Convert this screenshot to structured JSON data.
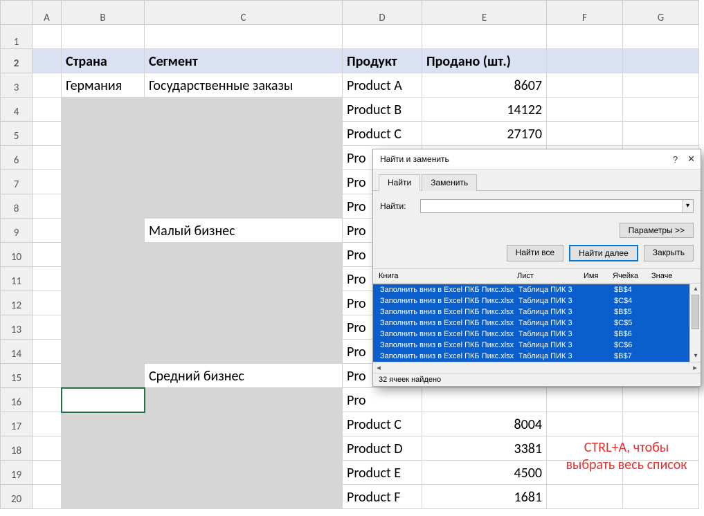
{
  "columns": [
    "A",
    "B",
    "C",
    "D",
    "E",
    "F",
    "G"
  ],
  "rows_count": 20,
  "header_row": {
    "B": "Страна",
    "C": "Сегмент",
    "D": "Продукт",
    "E": "Продано (шт.)"
  },
  "data": {
    "3": {
      "B": "Германия",
      "C": "Государственные заказы",
      "D": "Product A",
      "E": "8607"
    },
    "4": {
      "D": "Product B",
      "E": "14122"
    },
    "5": {
      "D": "Product C",
      "E": "27170"
    },
    "6": {
      "D": "Pro"
    },
    "7": {
      "D": "Pro"
    },
    "8": {
      "D": "Pro"
    },
    "9": {
      "C": "Малый бизнес",
      "D": "Pro"
    },
    "10": {
      "D": "Pro"
    },
    "11": {
      "D": "Pro"
    },
    "12": {
      "D": "Pro"
    },
    "13": {
      "D": "Pro"
    },
    "14": {
      "D": "Pro"
    },
    "15": {
      "C": "Средний бизнес",
      "D": "Pro"
    },
    "16": {
      "D": "Pro"
    },
    "17": {
      "D": "Product C",
      "E": "8004"
    },
    "18": {
      "D": "Product D",
      "E": "3381"
    },
    "19": {
      "D": "Product E",
      "E": "4500"
    },
    "20": {
      "D": "Product F",
      "E": "1681"
    }
  },
  "annotation": {
    "line1": "CTRL+A, чтобы",
    "line2": "выбрать весь список"
  },
  "dialog": {
    "title": "Найти и заменить",
    "help": "?",
    "close": "✕",
    "tabs": {
      "find": "Найти",
      "replace": "Заменить"
    },
    "find_label": "Найти:",
    "params_btn": "Параметры >>",
    "find_all": "Найти все",
    "find_next": "Найти далее",
    "close_btn": "Закрыть",
    "cols": {
      "book": "Книга",
      "sheet": "Лист",
      "name": "Имя",
      "cell": "Ячейка",
      "value": "Значе"
    },
    "results": [
      {
        "book": "Заполнить вниз в Excel ПКБ Пикс.xlsx",
        "sheet": "Таблица ПИК 3",
        "cell": "$B$4"
      },
      {
        "book": "Заполнить вниз в Excel ПКБ Пикс.xlsx",
        "sheet": "Таблица ПИК 3",
        "cell": "$C$4"
      },
      {
        "book": "Заполнить вниз в Excel ПКБ Пикс.xlsx",
        "sheet": "Таблица ПИК 3",
        "cell": "$B$5"
      },
      {
        "book": "Заполнить вниз в Excel ПКБ Пикс.xlsx",
        "sheet": "Таблица ПИК 3",
        "cell": "$C$5"
      },
      {
        "book": "Заполнить вниз в Excel ПКБ Пикс.xlsx",
        "sheet": "Таблица ПИК 3",
        "cell": "$B$6"
      },
      {
        "book": "Заполнить вниз в Excel ПКБ Пикс.xlsx",
        "sheet": "Таблица ПИК 3",
        "cell": "$C$6"
      },
      {
        "book": "Заполнить вниз в Excel ПКБ Пикс.xlsx",
        "sheet": "Таблица ПИК 3",
        "cell": "$B$7"
      }
    ],
    "status": "32 ячеек найдено"
  }
}
